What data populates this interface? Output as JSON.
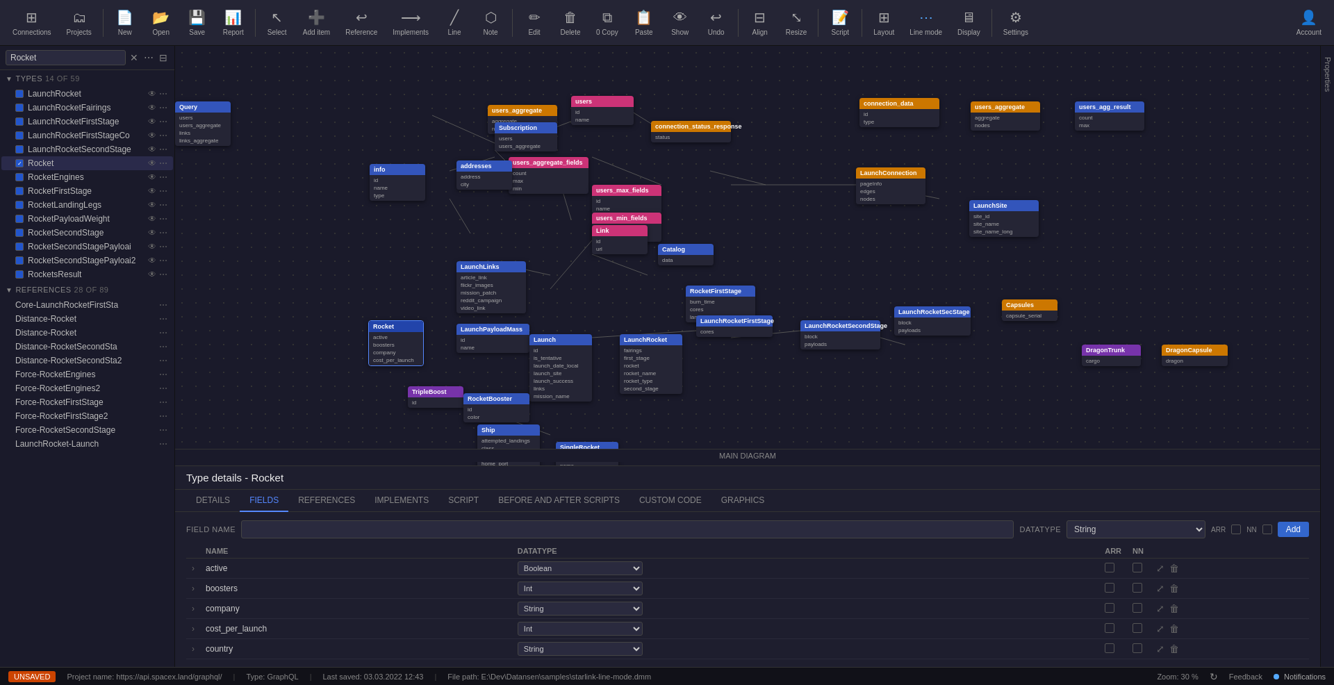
{
  "toolbar": {
    "groups": [
      {
        "id": "connections",
        "icon": "⊞",
        "label": "Connections"
      },
      {
        "id": "projects",
        "icon": "🗂",
        "label": "Projects"
      },
      {
        "id": "new",
        "icon": "📄",
        "label": "New"
      },
      {
        "id": "open",
        "icon": "📂",
        "label": "Open"
      },
      {
        "id": "save",
        "icon": "💾",
        "label": "Save"
      },
      {
        "id": "report",
        "icon": "📊",
        "label": "Report"
      },
      {
        "id": "select",
        "icon": "↖",
        "label": "Select"
      },
      {
        "id": "add-item",
        "icon": "➕",
        "label": "Add item"
      },
      {
        "id": "reference",
        "icon": "↩",
        "label": "Reference"
      },
      {
        "id": "implements",
        "icon": "⟶",
        "label": "Implements"
      },
      {
        "id": "line",
        "icon": "╱",
        "label": "Line"
      },
      {
        "id": "note",
        "icon": "⬡",
        "label": "Note"
      },
      {
        "id": "edit",
        "icon": "✏",
        "label": "Edit"
      },
      {
        "id": "delete",
        "icon": "🗑",
        "label": "Delete"
      },
      {
        "id": "copy",
        "icon": "⧉",
        "label": "Copy"
      },
      {
        "id": "paste",
        "icon": "📋",
        "label": "Paste"
      },
      {
        "id": "show",
        "icon": "👁",
        "label": "Show"
      },
      {
        "id": "undo",
        "icon": "↩",
        "label": "Undo"
      },
      {
        "id": "align",
        "icon": "⊟",
        "label": "Align"
      },
      {
        "id": "resize",
        "icon": "⤡",
        "label": "Resize"
      },
      {
        "id": "script",
        "icon": "📝",
        "label": "Script"
      },
      {
        "id": "layout",
        "icon": "⊞",
        "label": "Layout"
      },
      {
        "id": "line-mode",
        "icon": "⋯",
        "label": "Line mode"
      },
      {
        "id": "display",
        "icon": "🖥",
        "label": "Display"
      },
      {
        "id": "settings",
        "icon": "⚙",
        "label": "Settings"
      },
      {
        "id": "account",
        "icon": "👤",
        "label": "Account"
      }
    ]
  },
  "sidebar": {
    "search_placeholder": "Rocket",
    "types_section": {
      "label": "TYPES",
      "count": "14 of 59",
      "items": [
        {
          "name": "LaunchRocket",
          "active": false,
          "checked": false
        },
        {
          "name": "LaunchRocketFairings",
          "active": false,
          "checked": false
        },
        {
          "name": "LaunchRocketFirstStage",
          "active": false,
          "checked": false
        },
        {
          "name": "LaunchRocketFirstStageCo",
          "active": false,
          "checked": false
        },
        {
          "name": "LaunchRocketSecondStage",
          "active": false,
          "checked": false
        },
        {
          "name": "Rocket",
          "active": true,
          "checked": true
        },
        {
          "name": "RocketEngines",
          "active": false,
          "checked": false
        },
        {
          "name": "RocketFirstStage",
          "active": false,
          "checked": false
        },
        {
          "name": "RocketLandingLegs",
          "active": false,
          "checked": false
        },
        {
          "name": "RocketPayloadWeight",
          "active": false,
          "checked": false
        },
        {
          "name": "RocketSecondStage",
          "active": false,
          "checked": false
        },
        {
          "name": "RocketSecondStagePayloai",
          "active": false,
          "checked": false
        },
        {
          "name": "RocketSecondStagePayloai2",
          "active": false,
          "checked": false
        },
        {
          "name": "RocketsResult",
          "active": false,
          "checked": false
        }
      ]
    },
    "references_section": {
      "label": "REFERENCES",
      "count": "28 of 89",
      "items": [
        {
          "name": "Core-LaunchRocketFirstSta"
        },
        {
          "name": "Distance-Rocket"
        },
        {
          "name": "Distance-Rocket"
        },
        {
          "name": "Distance-RocketSecondSta"
        },
        {
          "name": "Distance-RocketSecondSta2"
        },
        {
          "name": "Force-RocketEngines"
        },
        {
          "name": "Force-RocketEngines2"
        },
        {
          "name": "Force-RocketFirstStage"
        },
        {
          "name": "Force-RocketFirstStage2"
        },
        {
          "name": "Force-RocketSecondStage"
        },
        {
          "name": "LaunchRocket-Launch"
        }
      ]
    }
  },
  "canvas": {
    "diagram_label": "MAIN DIAGRAM"
  },
  "bottom_panel": {
    "title": "Type details - Rocket",
    "tabs": [
      "DETAILS",
      "FIELDS",
      "REFERENCES",
      "IMPLEMENTS",
      "SCRIPT",
      "BEFORE AND AFTER SCRIPTS",
      "CUSTOM CODE",
      "GRAPHICS"
    ],
    "active_tab": "FIELDS",
    "field_header": {
      "field_name_label": "FIELD NAME",
      "datatype_label": "DATATYPE",
      "arr_label": "ARR",
      "nn_label": "NN",
      "add_button": "Add",
      "datatype_value": "String"
    },
    "table": {
      "columns": [
        "NAME",
        "DATATYPE",
        "ARR",
        "NN",
        ""
      ],
      "rows": [
        {
          "name": "active",
          "datatype": "Boolean"
        },
        {
          "name": "boosters",
          "datatype": "Int"
        },
        {
          "name": "company",
          "datatype": "String"
        },
        {
          "name": "cost_per_launch",
          "datatype": "Int"
        },
        {
          "name": "country",
          "datatype": "String"
        }
      ]
    }
  },
  "status_bar": {
    "unsaved": "UNSAVED",
    "project": "Project name: https://api.spacex.land/graphql/",
    "type": "Type: GraphQL",
    "last_saved": "Last saved: 03.03.2022 12:43",
    "file_path": "File path: E:\\Dev\\Datansen\\samples\\starlink-line-mode.dmm",
    "zoom": "Zoom: 30 %",
    "refresh_icon": "↻",
    "feedback": "Feedback",
    "notifications": "Notifications"
  },
  "right_panel": {
    "properties_label": "Properties"
  },
  "copy_badge": "0 Copy"
}
